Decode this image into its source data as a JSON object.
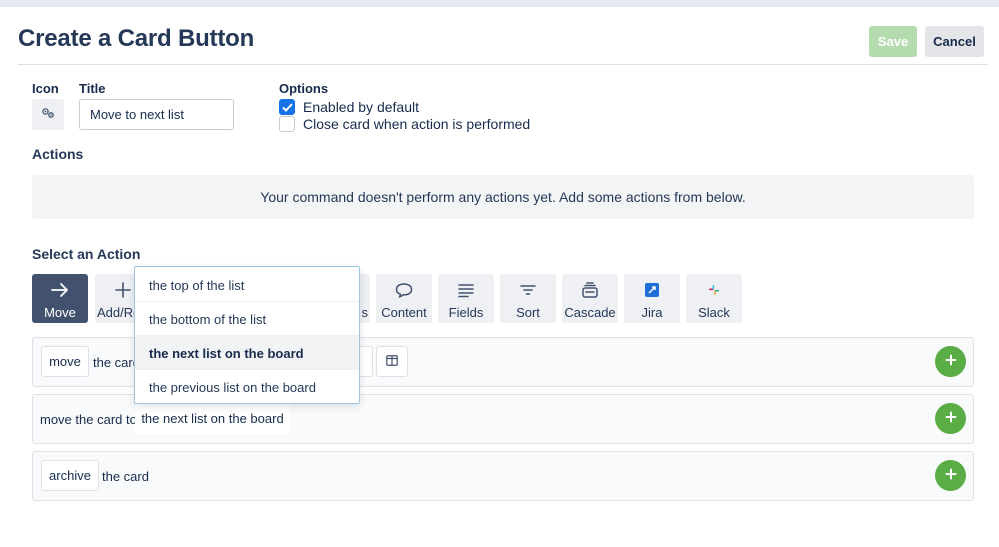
{
  "header": {
    "title": "Create a Card Button",
    "save_label": "Save",
    "cancel_label": "Cancel"
  },
  "form": {
    "icon_label": "Icon",
    "title_label": "Title",
    "title_value": "Move to next list",
    "options_label": "Options",
    "options": [
      {
        "label": "Enabled by default",
        "checked": true
      },
      {
        "label": "Close card when action is performed",
        "checked": false
      }
    ]
  },
  "actions": {
    "heading": "Actions",
    "empty_message": "Your command doesn't perform any actions yet. Add some actions from below."
  },
  "select_action": {
    "heading": "Select an Action",
    "tiles": [
      {
        "label": "Move",
        "icon": "arrow-right-icon",
        "active": true
      },
      {
        "label": "Add/Re",
        "icon": "plus-icon",
        "active": false
      },
      {
        "label": "s",
        "icon": "",
        "active": false
      },
      {
        "label": "Content",
        "icon": "speech-bubble-icon",
        "active": false
      },
      {
        "label": "Fields",
        "icon": "lines-icon",
        "active": false
      },
      {
        "label": "Sort",
        "icon": "sort-icon",
        "active": false
      },
      {
        "label": "Cascade",
        "icon": "cascade-icon",
        "active": false
      },
      {
        "label": "Jira",
        "icon": "jira-icon",
        "active": false
      },
      {
        "label": "Slack",
        "icon": "slack-icon",
        "active": false
      }
    ]
  },
  "action_rows": [
    {
      "chip": "move",
      "text": "the card"
    },
    {
      "prefix": "move the card to",
      "chip": "the next list on the board"
    },
    {
      "chip": "archive",
      "text": "the card"
    }
  ],
  "dropdown": {
    "options": [
      {
        "label": "the top of the list",
        "selected": false
      },
      {
        "label": "the bottom of the list",
        "selected": false
      },
      {
        "label": "the next list on the board",
        "selected": true
      },
      {
        "label": "the previous list on the board",
        "selected": false
      }
    ]
  },
  "colors": {
    "accent_green": "#5aac44",
    "save_disabled": "#b4dcaf",
    "checkbox_blue": "#1672e7",
    "active_tile": "#42526e"
  }
}
